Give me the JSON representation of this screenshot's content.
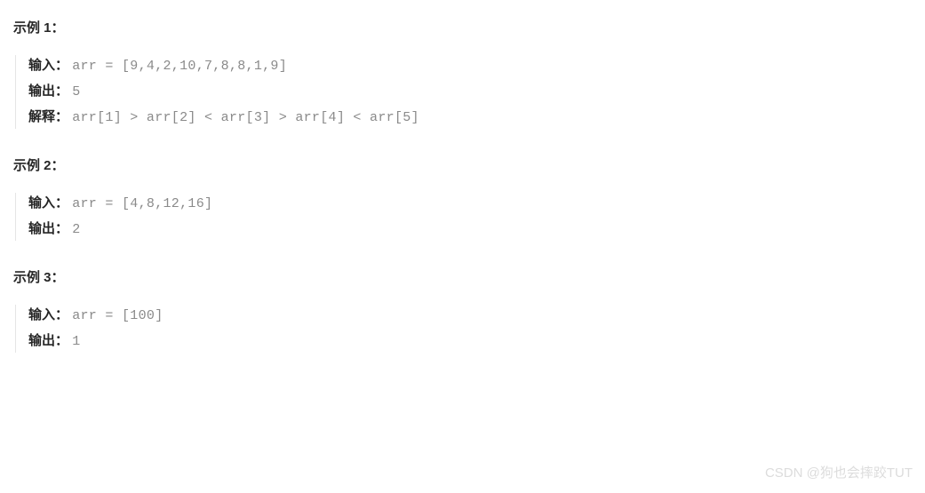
{
  "examples": [
    {
      "heading": "示例 1：",
      "input_label": "输入：",
      "input_code": "arr = [9,4,2,10,7,8,8,1,9]",
      "output_label": "输出：",
      "output_code": "5",
      "explain_label": "解释：",
      "explain_code": "arr[1] > arr[2] < arr[3] > arr[4] < arr[5]"
    },
    {
      "heading": "示例 2：",
      "input_label": "输入：",
      "input_code": "arr = [4,8,12,16]",
      "output_label": "输出：",
      "output_code": "2"
    },
    {
      "heading": "示例 3：",
      "input_label": "输入：",
      "input_code": "arr = [100]",
      "output_label": "输出：",
      "output_code": "1"
    }
  ],
  "watermark": "CSDN @狗也会摔跤TUT"
}
